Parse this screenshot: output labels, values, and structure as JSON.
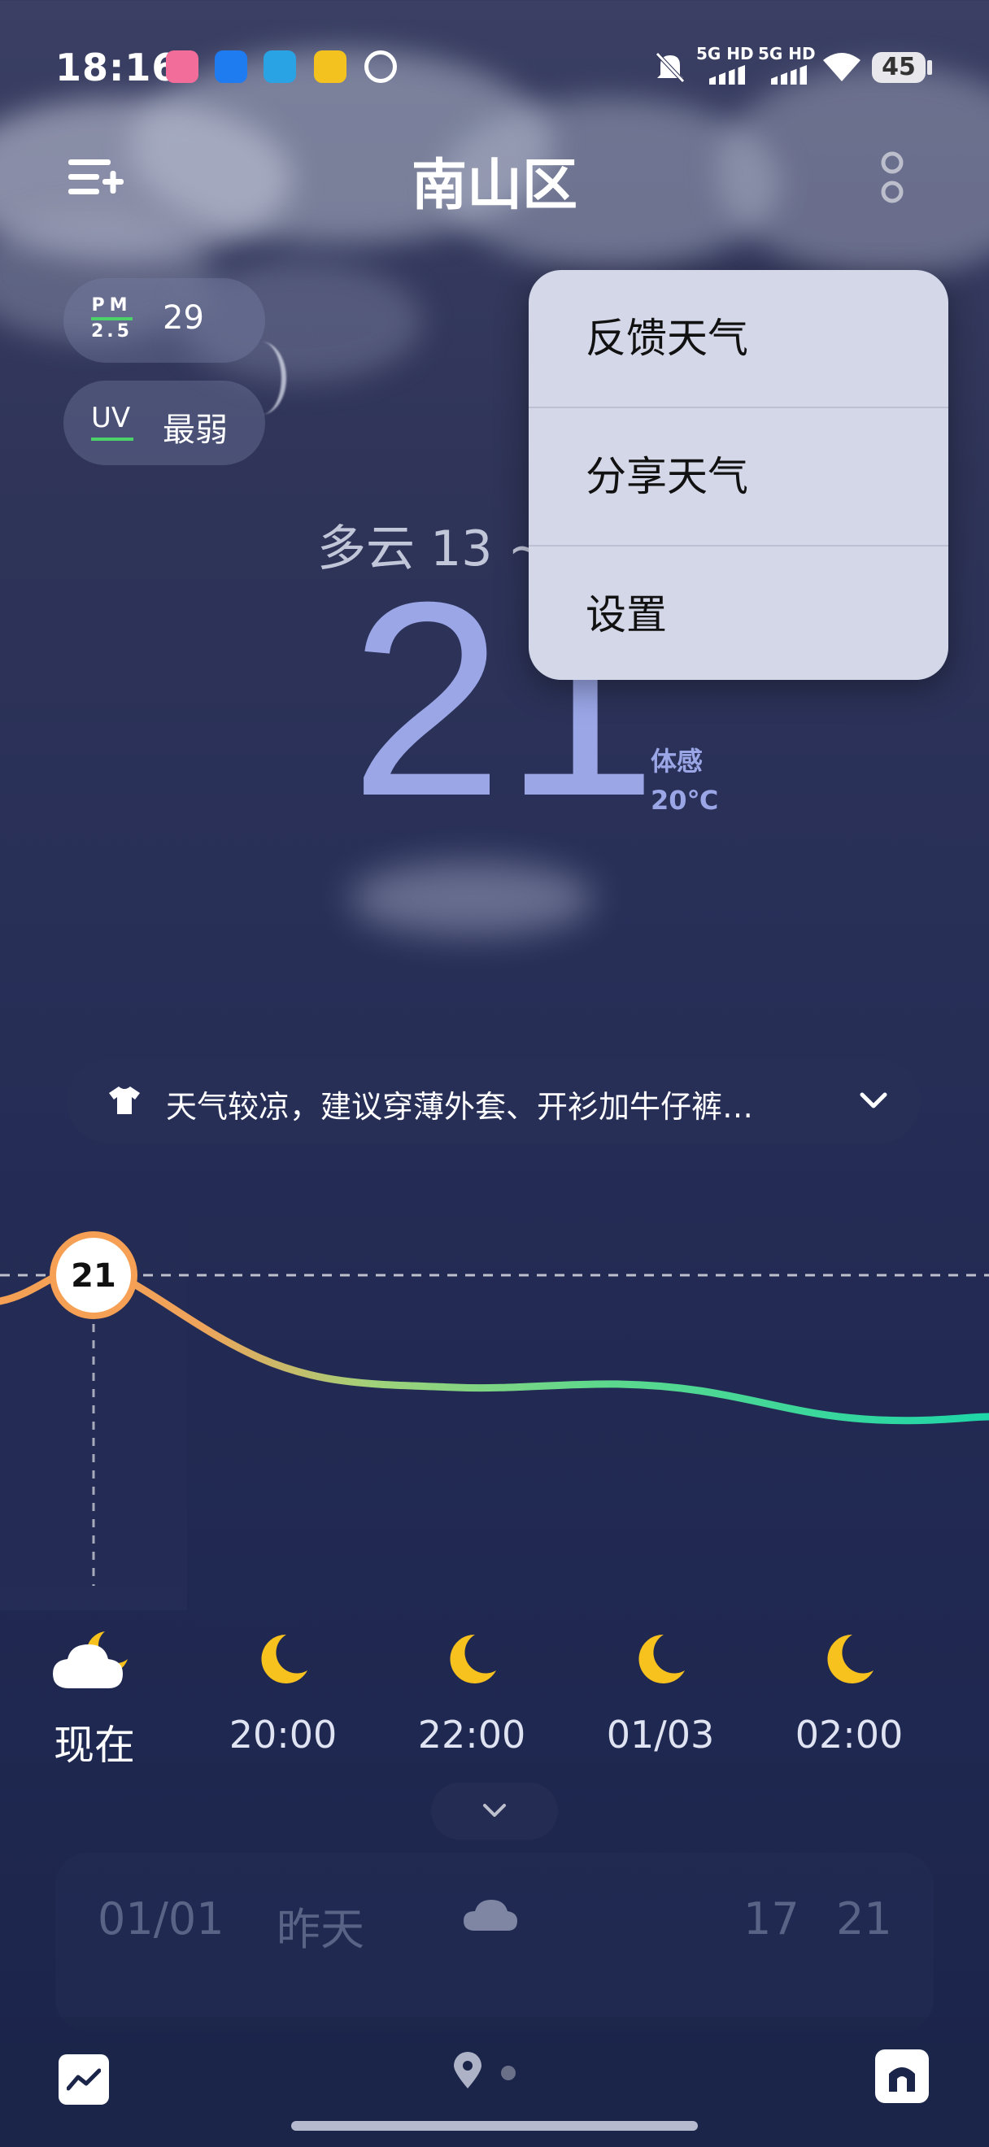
{
  "status_bar": {
    "time": "18:16",
    "network1": "5G HD",
    "network2": "5G HD",
    "battery": "45"
  },
  "header": {
    "city": "南山区"
  },
  "indicators": {
    "pm_label_top": "PM",
    "pm_label_bottom": "2.5",
    "pm_value": "29",
    "uv_label": "UV",
    "uv_value": "最弱"
  },
  "current": {
    "condition": "多云  13 ~",
    "temperature": "21",
    "feels_label": "体感",
    "feels_value": "20℃"
  },
  "menu": {
    "items": [
      "反馈天气",
      "分享天气",
      "设置"
    ]
  },
  "tip": {
    "text": "天气较凉，建议穿薄外套、开衫加牛仔裤…"
  },
  "chart_data": {
    "type": "line",
    "x": [
      "现在",
      "20:00",
      "22:00",
      "01/03",
      "02:00"
    ],
    "current_marker": "21"
  },
  "hourly": [
    {
      "label": "现在",
      "icon": "partly-cloudy-night-icon"
    },
    {
      "label": "20:00",
      "icon": "moon-icon"
    },
    {
      "label": "22:00",
      "icon": "moon-icon"
    },
    {
      "label": "01/03",
      "icon": "moon-icon"
    },
    {
      "label": "02:00",
      "icon": "moon-icon"
    }
  ],
  "daily": [
    {
      "date": "01/01",
      "day": "昨天",
      "low": "17",
      "high": "21",
      "icon": "cloud-icon"
    }
  ],
  "colors": {
    "accent_temp": "#9aa6e6",
    "curve_start": "#f5a054",
    "curve_end": "#1ed6a8",
    "moon": "#f8c21e"
  }
}
